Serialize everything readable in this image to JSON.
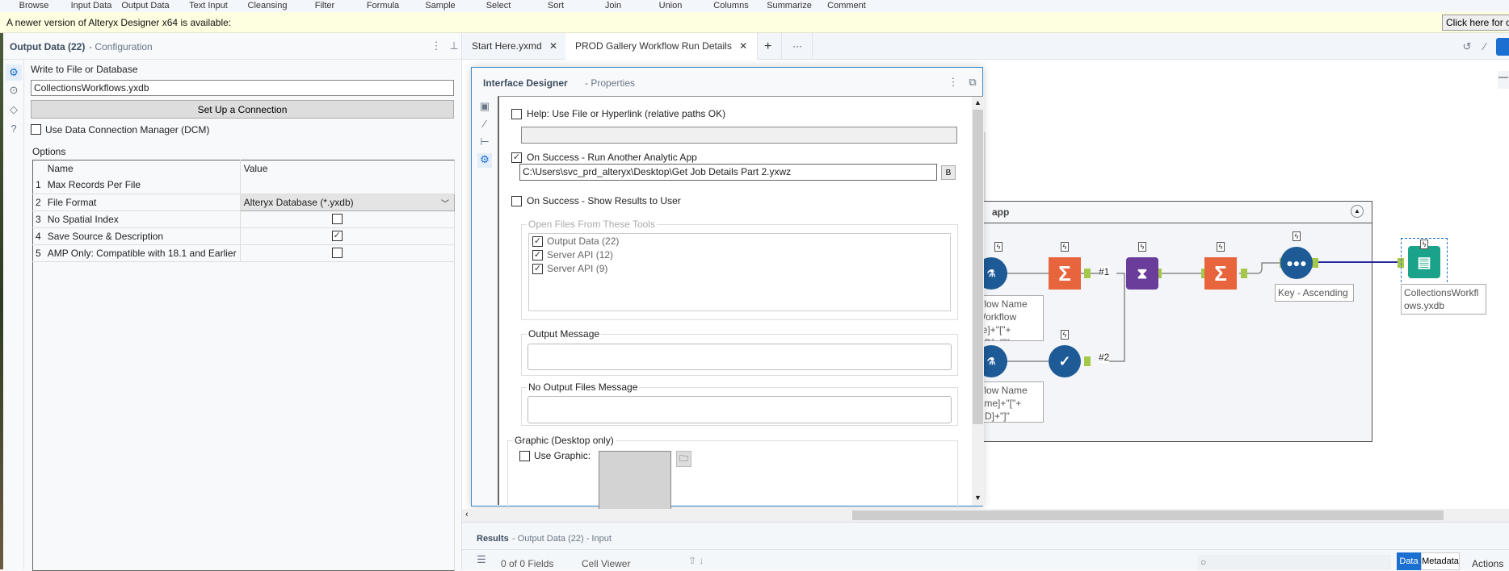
{
  "ribbon": {
    "tools": [
      "Browse",
      "Input Data",
      "Output Data",
      "Text Input",
      "Cleansing",
      "Filter",
      "Formula",
      "Sample",
      "Select",
      "Sort",
      "Join",
      "Union",
      "Columns",
      "Summarize",
      "Comment"
    ]
  },
  "banner": {
    "text": "A newer version of Alteryx Designer x64 is available:",
    "button": "Click here for options"
  },
  "config": {
    "title": "Output Data (22)",
    "subtitle": "- Configuration",
    "write_label": "Write to File or Database",
    "file_value": "CollectionsWorkflows.yxdb",
    "setup_button": "Set Up a Connection",
    "dcm_label": "Use Data Connection Manager (DCM)",
    "dcm_checked": false,
    "options_label": "Options",
    "table": {
      "headers": [
        "Name",
        "Value"
      ],
      "rows": [
        {
          "n": "1",
          "name": "Max Records Per File",
          "value": ""
        },
        {
          "n": "2",
          "name": "File Format",
          "value": "Alteryx Database (*.yxdb)"
        },
        {
          "n": "3",
          "name": "No Spatial Index",
          "checked": false
        },
        {
          "n": "4",
          "name": "Save Source & Description",
          "checked": true
        },
        {
          "n": "5",
          "name": "AMP Only: Compatible with 18.1 and Earlier",
          "checked": false
        }
      ]
    }
  },
  "tabs": [
    {
      "label": "Start Here.yxmd"
    },
    {
      "label": "PROD Gallery Workflow Run Details"
    }
  ],
  "dialog": {
    "title": "Interface Designer",
    "subtitle": "- Properties",
    "help_label": "Help: Use File or Hyperlink (relative paths OK)",
    "help_value": "",
    "run_app_label": "On Success - Run Another Analytic App",
    "run_app_path": "C:\\Users\\svc_prd_alteryx\\Desktop\\Get Job Details Part 2.yxwz",
    "browse": "B",
    "show_results_label": "On Success - Show Results to User",
    "open_files_legend": "Open Files From These Tools",
    "open_files": [
      "Output Data (22)",
      "Server API (12)",
      "Server API (9)"
    ],
    "output_message_legend": "Output Message",
    "no_output_legend": "No Output Files Message",
    "graphic_legend": "Graphic (Desktop only)",
    "use_graphic_label": "Use Graphic:"
  },
  "workflow": {
    "container_title": "app",
    "annotations": [
      "kflow Name\nWorkflow\nne]+\"[\"+\npID]+\"]\"",
      "kflow Name\nlame]+\"[\"+\npID]+\"]\""
    ],
    "sort_label": "Key - Ascending",
    "output_label": "CollectionsWorkfl\nows.yxdb",
    "conn1": "#1",
    "conn2": "#2"
  },
  "results": {
    "title": "Results",
    "subtitle": "- Output Data (22) - Input",
    "fields": "0 of 0 Fields",
    "cell_viewer": "Cell Viewer",
    "data_btn": "Data",
    "metadata_btn": "Metadata",
    "actions": "Actions"
  },
  "colors": {
    "accent": "#1a6fd0",
    "summarize": "#e8643c",
    "dna": "#6a3d9a",
    "blue_tool": "#1d5a96",
    "output_tool": "#1aa38a",
    "anchor": "#a6c84a"
  }
}
